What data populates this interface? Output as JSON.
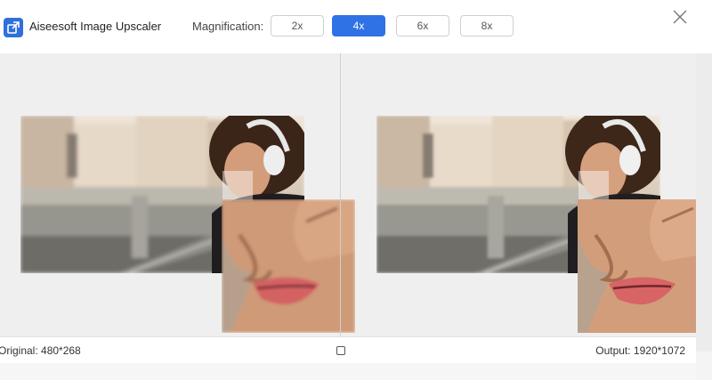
{
  "app": {
    "title": "Aiseesoft Image Upscaler",
    "icon": "upscale-app-icon",
    "accent_color": "#2e72e6"
  },
  "magnification": {
    "label": "Magnification:",
    "options": [
      "2x",
      "4x",
      "6x",
      "8x"
    ],
    "selected": "4x"
  },
  "window_controls": {
    "close_icon": "close-icon"
  },
  "footer": {
    "original_text": "Original: 480*268",
    "output_text": "Output: 1920*1072",
    "fullscreen_icon": "fullscreen-icon"
  }
}
